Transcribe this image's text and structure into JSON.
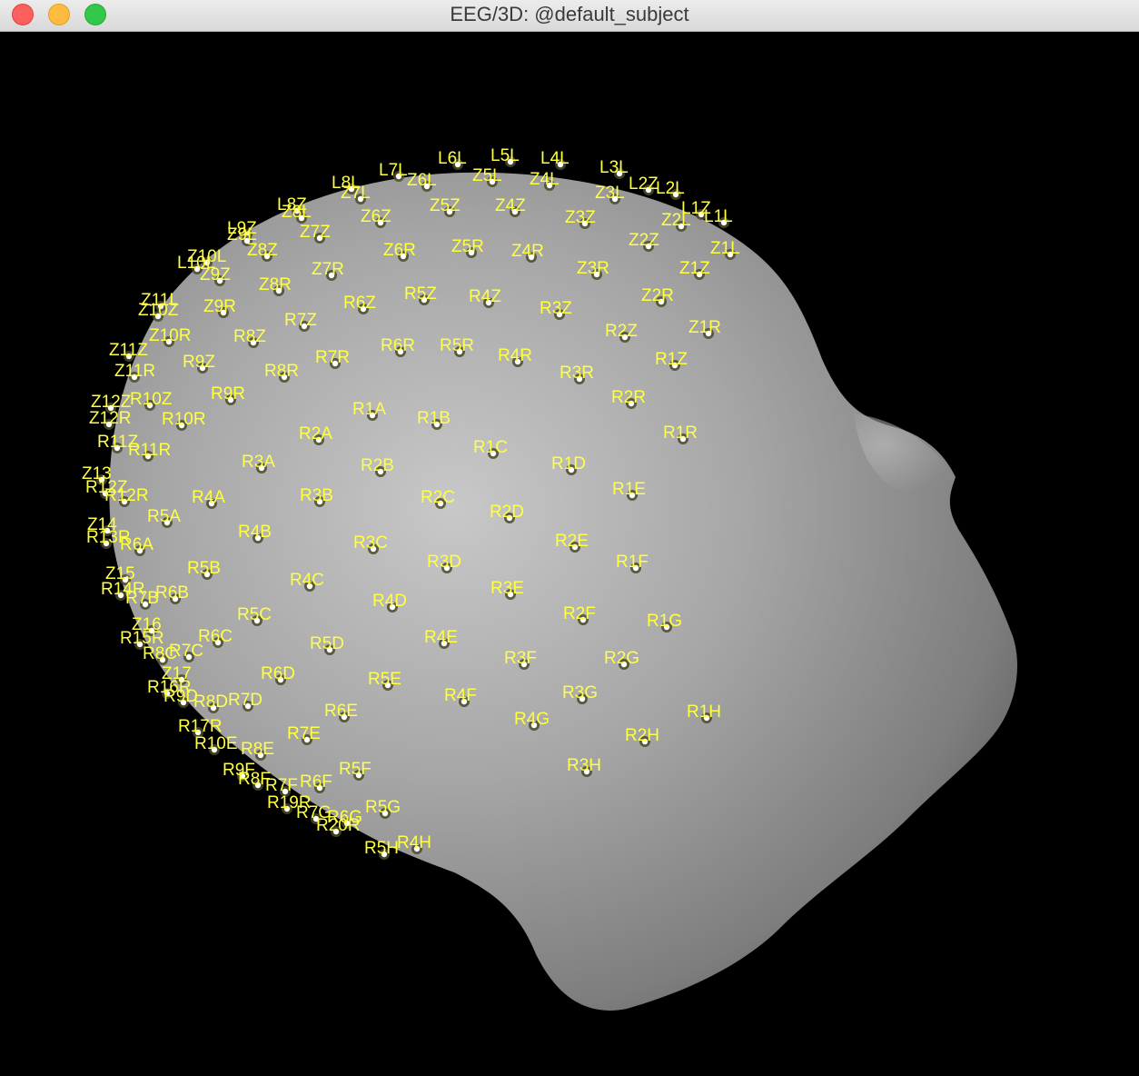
{
  "window": {
    "title": "EEG/3D: @default_subject",
    "controls": [
      "close",
      "minimize",
      "zoom"
    ]
  },
  "scene": {
    "background_color": "#000000",
    "head_color": "#a9a9a9",
    "label_color": "#ffff44",
    "marker_fill": "#ffffff",
    "marker_ring": "#4a4a2a"
  },
  "electrodes": [
    {
      "name": "L6L"
    },
    {
      "name": "L5L"
    },
    {
      "name": "L4L"
    },
    {
      "name": "L3L"
    },
    {
      "name": "L2Z"
    },
    {
      "name": "L2L"
    },
    {
      "name": "L1Z"
    },
    {
      "name": "L1L"
    },
    {
      "name": "Z1L"
    },
    {
      "name": "L7L"
    },
    {
      "name": "L8L"
    },
    {
      "name": "L8Z"
    },
    {
      "name": "L9Z"
    },
    {
      "name": "L10L"
    },
    {
      "name": "Z6L"
    },
    {
      "name": "Z5L"
    },
    {
      "name": "Z4L"
    },
    {
      "name": "Z3L"
    },
    {
      "name": "Z2L"
    },
    {
      "name": "Z7L"
    },
    {
      "name": "Z8L"
    },
    {
      "name": "Z9L"
    },
    {
      "name": "Z6Z"
    },
    {
      "name": "Z5Z"
    },
    {
      "name": "Z4Z"
    },
    {
      "name": "Z3Z"
    },
    {
      "name": "Z2Z"
    },
    {
      "name": "Z1Z"
    },
    {
      "name": "Z7Z"
    },
    {
      "name": "Z8Z"
    },
    {
      "name": "Z6R"
    },
    {
      "name": "Z5R"
    },
    {
      "name": "Z4R"
    },
    {
      "name": "Z3R"
    },
    {
      "name": "Z2R"
    },
    {
      "name": "Z1R"
    },
    {
      "name": "Z7R"
    },
    {
      "name": "Z8R"
    },
    {
      "name": "Z9Z"
    },
    {
      "name": "Z10L"
    },
    {
      "name": "R6Z"
    },
    {
      "name": "R5Z"
    },
    {
      "name": "R4Z"
    },
    {
      "name": "R3Z"
    },
    {
      "name": "R2Z"
    },
    {
      "name": "R1Z"
    },
    {
      "name": "R7Z"
    },
    {
      "name": "Z9R"
    },
    {
      "name": "Z10Z"
    },
    {
      "name": "Z11L"
    },
    {
      "name": "R6R"
    },
    {
      "name": "R5R"
    },
    {
      "name": "R4R"
    },
    {
      "name": "R3R"
    },
    {
      "name": "R2R"
    },
    {
      "name": "R1R"
    },
    {
      "name": "R7R"
    },
    {
      "name": "R8R"
    },
    {
      "name": "R8Z"
    },
    {
      "name": "R9Z"
    },
    {
      "name": "Z10R"
    },
    {
      "name": "Z11Z"
    },
    {
      "name": "Z11R"
    },
    {
      "name": "R9R"
    },
    {
      "name": "R10Z"
    },
    {
      "name": "R10R"
    },
    {
      "name": "Z12Z"
    },
    {
      "name": "Z12R"
    },
    {
      "name": "R1A"
    },
    {
      "name": "R1B"
    },
    {
      "name": "R1C"
    },
    {
      "name": "R1D"
    },
    {
      "name": "R1E"
    },
    {
      "name": "R2A"
    },
    {
      "name": "R2B"
    },
    {
      "name": "R3A"
    },
    {
      "name": "R11Z"
    },
    {
      "name": "R11R"
    },
    {
      "name": "Z13"
    },
    {
      "name": "R12Z"
    },
    {
      "name": "R12R"
    },
    {
      "name": "R4A"
    },
    {
      "name": "R3B"
    },
    {
      "name": "R2C"
    },
    {
      "name": "R2D"
    },
    {
      "name": "R5A"
    },
    {
      "name": "R4B"
    },
    {
      "name": "R6A"
    },
    {
      "name": "R13R"
    },
    {
      "name": "Z14"
    },
    {
      "name": "R3C"
    },
    {
      "name": "R2E"
    },
    {
      "name": "R1F"
    },
    {
      "name": "R3D"
    },
    {
      "name": "R5B"
    },
    {
      "name": "R4C"
    },
    {
      "name": "R3E"
    },
    {
      "name": "R6B"
    },
    {
      "name": "R7B"
    },
    {
      "name": "R14R"
    },
    {
      "name": "Z15"
    },
    {
      "name": "R4D"
    },
    {
      "name": "R5C"
    },
    {
      "name": "R2F"
    },
    {
      "name": "R1G"
    },
    {
      "name": "R6C"
    },
    {
      "name": "R4E"
    },
    {
      "name": "R5D"
    },
    {
      "name": "R7C"
    },
    {
      "name": "R8C"
    },
    {
      "name": "R15R"
    },
    {
      "name": "Z16"
    },
    {
      "name": "R3F"
    },
    {
      "name": "R2G"
    },
    {
      "name": "R6D"
    },
    {
      "name": "R5E"
    },
    {
      "name": "R3G"
    },
    {
      "name": "R4F"
    },
    {
      "name": "R7D"
    },
    {
      "name": "R8D"
    },
    {
      "name": "R9D"
    },
    {
      "name": "R16R"
    },
    {
      "name": "Z17"
    },
    {
      "name": "R1H"
    },
    {
      "name": "R6E"
    },
    {
      "name": "R4G"
    },
    {
      "name": "R2H"
    },
    {
      "name": "R7E"
    },
    {
      "name": "R17R"
    },
    {
      "name": "R10E"
    },
    {
      "name": "R8E"
    },
    {
      "name": "R3H"
    },
    {
      "name": "R5F"
    },
    {
      "name": "R6F"
    },
    {
      "name": "R7F"
    },
    {
      "name": "R8F"
    },
    {
      "name": "R9F"
    },
    {
      "name": "R19R"
    },
    {
      "name": "R5G"
    },
    {
      "name": "R6G"
    },
    {
      "name": "R7G"
    },
    {
      "name": "R20R"
    },
    {
      "name": "R4H"
    },
    {
      "name": "R5H"
    }
  ]
}
